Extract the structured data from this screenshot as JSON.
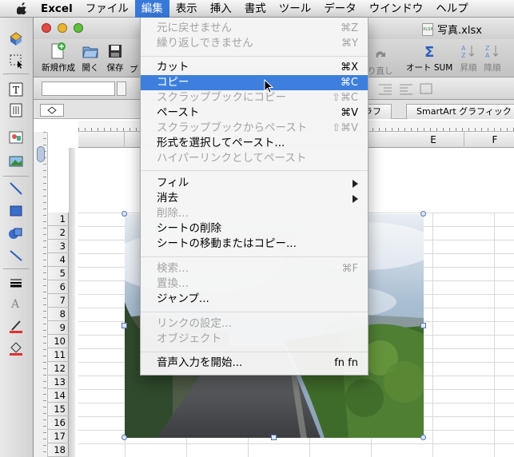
{
  "menubar": {
    "app": "Excel",
    "items": [
      "ファイル",
      "編集",
      "表示",
      "挿入",
      "書式",
      "ツール",
      "データ",
      "ウインドウ",
      "ヘルプ"
    ]
  },
  "window": {
    "title": "写真.xlsx",
    "file_icon_text": "XLSX"
  },
  "toolbar": {
    "new": "新規作成",
    "open": "開く",
    "save": "保存",
    "partial": "プ",
    "redo": "り直し",
    "autosum": "オート SUM",
    "sort_asc": "昇順",
    "sort_desc": "降順"
  },
  "ribbon_tabs": {
    "graph": "ラフ",
    "smartart": "SmartArt グラフィック"
  },
  "columns": [
    "E",
    "F"
  ],
  "rows": [
    "1",
    "2",
    "3",
    "4",
    "5",
    "6",
    "7",
    "8",
    "9",
    "10",
    "11",
    "12",
    "13",
    "14",
    "15",
    "16",
    "17",
    "18"
  ],
  "edit_menu": {
    "items": [
      {
        "label": "元に戻せません",
        "shortcut": "⌘Z",
        "disabled": true
      },
      {
        "label": "繰り返しできません",
        "shortcut": "⌘Y",
        "disabled": true
      },
      {
        "label": "カット",
        "shortcut": "⌘X",
        "disabled": false
      },
      {
        "label": "コピー",
        "shortcut": "⌘C",
        "disabled": false,
        "highlighted": true
      },
      {
        "label": "スクラップブックにコピー",
        "shortcut": "⇧⌘C",
        "disabled": true
      },
      {
        "label": "ペースト",
        "shortcut": "⌘V",
        "disabled": false
      },
      {
        "label": "スクラップブックからペースト",
        "shortcut": "⇧⌘V",
        "disabled": true
      },
      {
        "label": "形式を選択してペースト...",
        "shortcut": "",
        "disabled": false
      },
      {
        "label": "ハイパーリンクとしてペースト",
        "shortcut": "",
        "disabled": true
      },
      {
        "label": "フィル",
        "shortcut": "",
        "disabled": false,
        "submenu": true
      },
      {
        "label": "消去",
        "shortcut": "",
        "disabled": false,
        "submenu": true
      },
      {
        "label": "削除...",
        "shortcut": "",
        "disabled": true
      },
      {
        "label": "シートの削除",
        "shortcut": "",
        "disabled": false
      },
      {
        "label": "シートの移動またはコピー...",
        "shortcut": "",
        "disabled": false
      },
      {
        "label": "検索...",
        "shortcut": "⌘F",
        "disabled": true
      },
      {
        "label": "置換...",
        "shortcut": "",
        "disabled": true
      },
      {
        "label": "ジャンプ...",
        "shortcut": "",
        "disabled": false
      },
      {
        "label": "リンクの設定...",
        "shortcut": "",
        "disabled": true
      },
      {
        "label": "オブジェクト",
        "shortcut": "",
        "disabled": true
      },
      {
        "label": "音声入力を開始...",
        "shortcut": "fn fn",
        "disabled": false
      }
    ]
  },
  "colors": {
    "menu_highlight": "#3e7fdd",
    "menubar_active": "#3878d8",
    "disabled_text": "#a4a4a4"
  }
}
